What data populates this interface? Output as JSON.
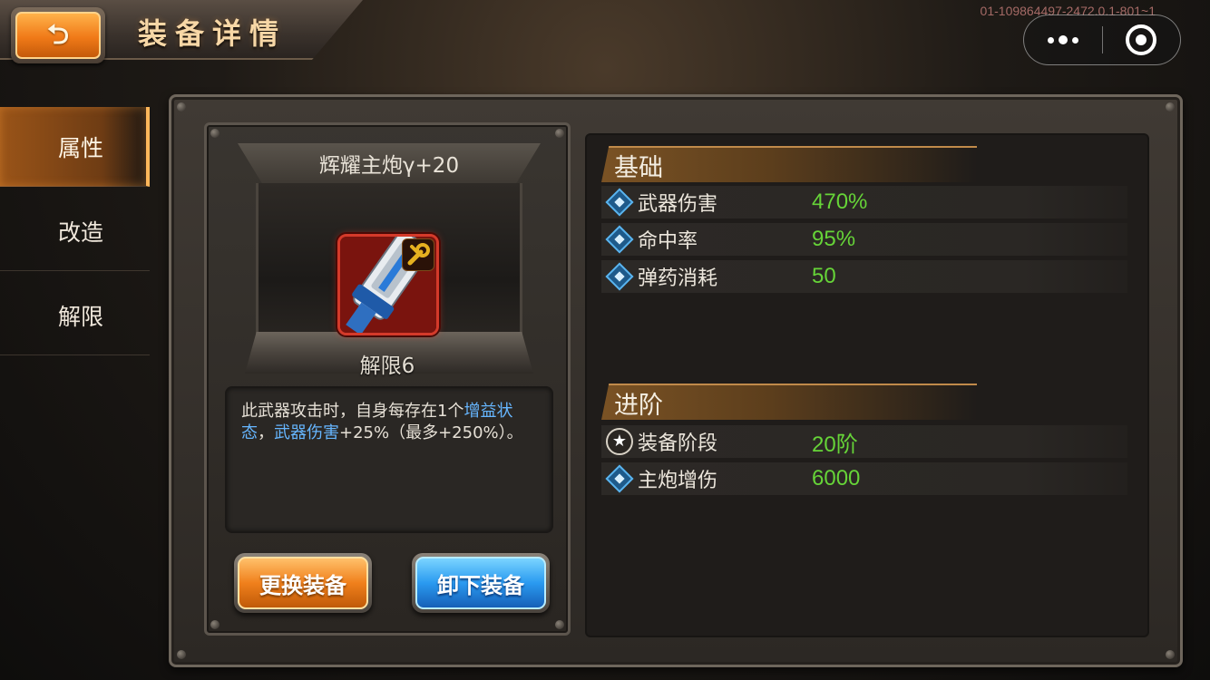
{
  "header": {
    "title": "装备详情",
    "back_icon": "back-arrow-icon",
    "build_id": "01-109864497-2472.0.1-801~1",
    "capsule": {
      "more_icon": "more-dots-icon",
      "close_icon": "close-circle-icon"
    }
  },
  "sidebar": {
    "tabs": [
      {
        "label": "属性",
        "active": true
      },
      {
        "label": "改造",
        "active": false
      },
      {
        "label": "解限",
        "active": false
      }
    ]
  },
  "equipment": {
    "name": "辉耀主炮γ+20",
    "limit_break": "解限6",
    "icon_frame_color": "#d43a2a",
    "badge_icon": "wrench-icon",
    "description": {
      "part1": "此武器攻击时，自身每存在1个",
      "highlight1": "增益状态",
      "part2": "，",
      "highlight2": "武器伤害",
      "part3": "+25%（最多+250%）。"
    },
    "buttons": {
      "replace": "更换装备",
      "unequip": "卸下装备"
    }
  },
  "stats": {
    "basic": {
      "title": "基础",
      "rows": [
        {
          "icon": "diamond-icon",
          "label": "武器伤害",
          "value": "470%"
        },
        {
          "icon": "diamond-icon",
          "label": "命中率",
          "value": "95%"
        },
        {
          "icon": "diamond-icon",
          "label": "弹药消耗",
          "value": "50"
        }
      ]
    },
    "advanced": {
      "title": "进阶",
      "rows": [
        {
          "icon": "star-icon",
          "label": "装备阶段",
          "value": "20阶"
        },
        {
          "icon": "diamond-icon",
          "label": "主炮增伤",
          "value": "6000"
        }
      ]
    }
  },
  "colors": {
    "accent_orange": "#f0801c",
    "accent_blue": "#2a9af0",
    "value_green": "#66d438",
    "highlight_blue": "#66b6ff"
  }
}
